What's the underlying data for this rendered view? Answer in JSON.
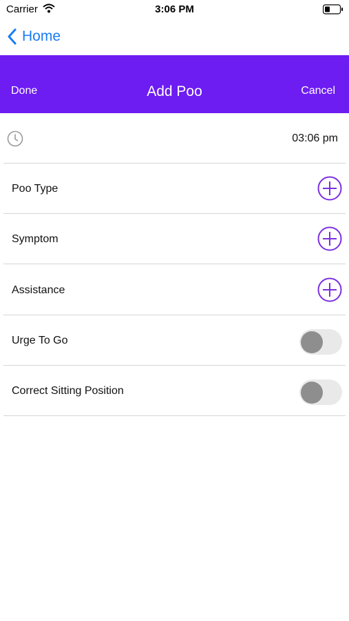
{
  "status_bar": {
    "carrier": "Carrier",
    "time": "3:06 PM"
  },
  "nav": {
    "back_label": "Home"
  },
  "header": {
    "done_label": "Done",
    "title": "Add Poo",
    "cancel_label": "Cancel",
    "background_color": "#6d1cf2"
  },
  "form": {
    "time_value": "03:06 pm",
    "rows": [
      {
        "label": "Poo Type"
      },
      {
        "label": "Symptom"
      },
      {
        "label": "Assistance"
      },
      {
        "label": "Urge To Go",
        "toggle_on": false
      },
      {
        "label": "Correct Sitting Position",
        "toggle_on": false
      }
    ]
  },
  "colors": {
    "accent": "#6d1cf2",
    "link": "#1a7cf5",
    "plus_icon": "#7b2ee0",
    "divider": "#d6d6d6"
  },
  "icons": [
    "wifi-icon",
    "battery-icon",
    "chevron-left-icon",
    "clock-icon",
    "plus-circle-icon"
  ]
}
